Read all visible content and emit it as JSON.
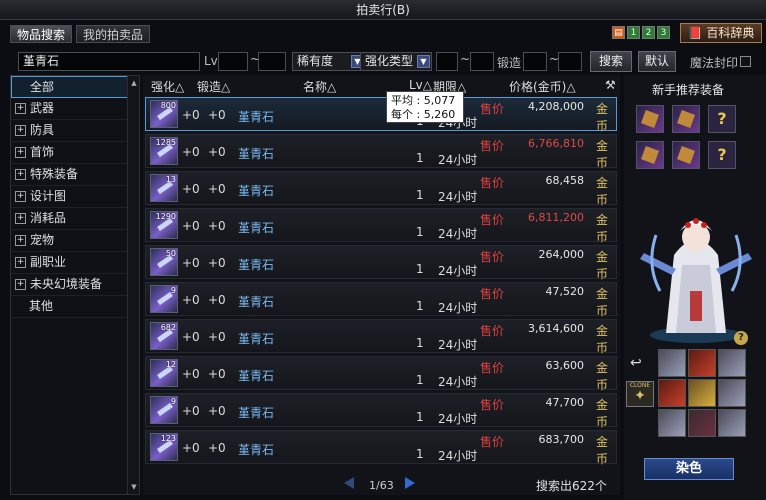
{
  "window": {
    "title": "拍卖行(B)"
  },
  "tabs": [
    {
      "label": "物品搜索",
      "active": true
    },
    {
      "label": "我的拍卖品",
      "active": false
    }
  ],
  "topbar": {
    "icon_numbers": [
      "1",
      "2",
      "3"
    ],
    "wiki_label": "百科辞典"
  },
  "search": {
    "keyword": "堇青石",
    "lv_label": "Lv",
    "lv_sep": "~",
    "rarity_label": "稀有度",
    "enhance_type_label": "强化类型",
    "forge_label": "锻造",
    "search_button": "搜索",
    "default_button": "默认",
    "seal_label": "魔法封印"
  },
  "categories": [
    {
      "label": "全部",
      "expandable": false,
      "active": true
    },
    {
      "label": "武器",
      "expandable": true
    },
    {
      "label": "防具",
      "expandable": true
    },
    {
      "label": "首饰",
      "expandable": true
    },
    {
      "label": "特殊装备",
      "expandable": true
    },
    {
      "label": "设计图",
      "expandable": true
    },
    {
      "label": "消耗品",
      "expandable": true
    },
    {
      "label": "宠物",
      "expandable": true
    },
    {
      "label": "副职业",
      "expandable": true
    },
    {
      "label": "未央幻境装备",
      "expandable": true
    },
    {
      "label": "其他",
      "expandable": false
    }
  ],
  "columns": {
    "enhance": "强化△",
    "forge": "锻造△",
    "name": "名称△",
    "lv": "Lv△",
    "duration": "期限△",
    "price": "价格(金币)△"
  },
  "rows": [
    {
      "count": "800",
      "enhance": "+0",
      "forge": "+0",
      "name": "堇青石",
      "lv": "1",
      "duration": "24小时",
      "type": "售价",
      "price": "4,208,000",
      "price_color": "#e6e6e6",
      "currency": "金币"
    },
    {
      "count": "1285",
      "enhance": "+0",
      "forge": "+0",
      "name": "堇青石",
      "lv": "1",
      "duration": "24小时",
      "type": "售价",
      "price": "6,766,810",
      "price_color": "#e04848",
      "currency": "金币"
    },
    {
      "count": "13",
      "enhance": "+0",
      "forge": "+0",
      "name": "堇青石",
      "lv": "1",
      "duration": "24小时",
      "type": "售价",
      "price": "68,458",
      "price_color": "#e6e6e6",
      "currency": "金币"
    },
    {
      "count": "1290",
      "enhance": "+0",
      "forge": "+0",
      "name": "堇青石",
      "lv": "1",
      "duration": "24小时",
      "type": "售价",
      "price": "6,811,200",
      "price_color": "#e04848",
      "currency": "金币"
    },
    {
      "count": "50",
      "enhance": "+0",
      "forge": "+0",
      "name": "堇青石",
      "lv": "1",
      "duration": "24小时",
      "type": "售价",
      "price": "264,000",
      "price_color": "#e6e6e6",
      "currency": "金币"
    },
    {
      "count": "9",
      "enhance": "+0",
      "forge": "+0",
      "name": "堇青石",
      "lv": "1",
      "duration": "24小时",
      "type": "售价",
      "price": "47,520",
      "price_color": "#e6e6e6",
      "currency": "金币"
    },
    {
      "count": "682",
      "enhance": "+0",
      "forge": "+0",
      "name": "堇青石",
      "lv": "1",
      "duration": "24小时",
      "type": "售价",
      "price": "3,614,600",
      "price_color": "#e6e6e6",
      "currency": "金币"
    },
    {
      "count": "12",
      "enhance": "+0",
      "forge": "+0",
      "name": "堇青石",
      "lv": "1",
      "duration": "24小时",
      "type": "售价",
      "price": "63,600",
      "price_color": "#e6e6e6",
      "currency": "金币"
    },
    {
      "count": "9",
      "enhance": "+0",
      "forge": "+0",
      "name": "堇青石",
      "lv": "1",
      "duration": "24小时",
      "type": "售价",
      "price": "47,700",
      "price_color": "#e6e6e6",
      "currency": "金币"
    },
    {
      "count": "123",
      "enhance": "+0",
      "forge": "+0",
      "name": "堇青石",
      "lv": "1",
      "duration": "24小时",
      "type": "售价",
      "price": "683,700",
      "price_color": "#e6e6e6",
      "currency": "金币"
    }
  ],
  "tooltip": {
    "avg_label": "平均",
    "avg_value": "5,077",
    "each_label": "每个",
    "each_value": "5,260"
  },
  "pager": {
    "text": "1/63"
  },
  "results": {
    "text": "搜索出622个"
  },
  "sidebar": {
    "title": "新手推荐装备",
    "dye_button": "染色",
    "clone_label": "CLONE",
    "help": "?"
  }
}
